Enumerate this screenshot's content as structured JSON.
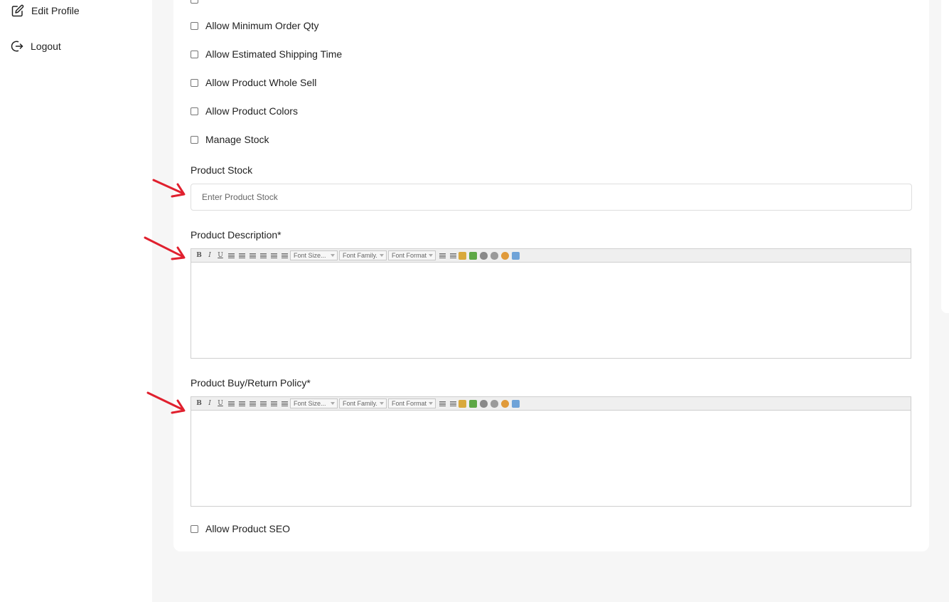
{
  "sidebar": {
    "items": [
      {
        "label": "Edit Profile",
        "icon": "edit-icon"
      },
      {
        "label": "Logout",
        "icon": "logout-icon"
      }
    ]
  },
  "options": [
    {
      "label": "Allow Minimum Order Qty"
    },
    {
      "label": "Allow Estimated Shipping Time"
    },
    {
      "label": "Allow Product Whole Sell"
    },
    {
      "label": "Allow Product Colors"
    },
    {
      "label": "Manage Stock"
    }
  ],
  "stock": {
    "label": "Product Stock",
    "placeholder": "Enter Product Stock"
  },
  "description": {
    "label": "Product Description*",
    "toolbar": {
      "font_size": "Font Size...",
      "font_family": "Font Family.",
      "font_format": "Font Format"
    }
  },
  "policy": {
    "label": "Product Buy/Return Policy*",
    "toolbar": {
      "font_size": "Font Size...",
      "font_family": "Font Family.",
      "font_format": "Font Format"
    }
  },
  "seo": {
    "label": "Allow Product SEO"
  },
  "colors": {
    "annotation_arrow": "#e0202e",
    "background": "#f6f6f6"
  }
}
